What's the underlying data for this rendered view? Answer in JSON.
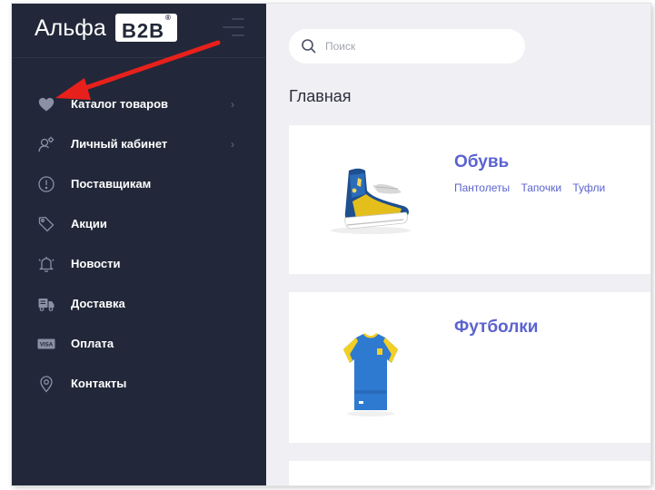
{
  "brand": {
    "name": "Альфа",
    "badge": "B2B",
    "badge_mark": "®"
  },
  "search": {
    "placeholder": "Поиск"
  },
  "page": {
    "title": "Главная"
  },
  "sidebar": {
    "items": [
      {
        "label": "Каталог товаров",
        "icon": "heart-icon",
        "has_submenu": true
      },
      {
        "label": "Личный кабинет",
        "icon": "user-settings-icon",
        "has_submenu": true
      },
      {
        "label": "Поставщикам",
        "icon": "alert-circle-icon",
        "has_submenu": false
      },
      {
        "label": "Акции",
        "icon": "tag-icon",
        "has_submenu": false
      },
      {
        "label": "Новости",
        "icon": "bell-icon",
        "has_submenu": false
      },
      {
        "label": "Доставка",
        "icon": "truck-icon",
        "has_submenu": false
      },
      {
        "label": "Оплата",
        "icon": "visa-card-icon",
        "has_submenu": false
      },
      {
        "label": "Контакты",
        "icon": "location-pin-icon",
        "has_submenu": false
      }
    ]
  },
  "categories": [
    {
      "title": "Обувь",
      "image": "sneaker-image",
      "subcategories": [
        "Пантолеты",
        "Тапочки",
        "Туфли"
      ]
    },
    {
      "title": "Футболки",
      "image": "tshirt-image",
      "subcategories": []
    }
  ],
  "colors": {
    "sidebar_bg": "#222839",
    "accent": "#5b63cf",
    "content_bg": "#f0eff4",
    "annotation": "#e8201c"
  }
}
